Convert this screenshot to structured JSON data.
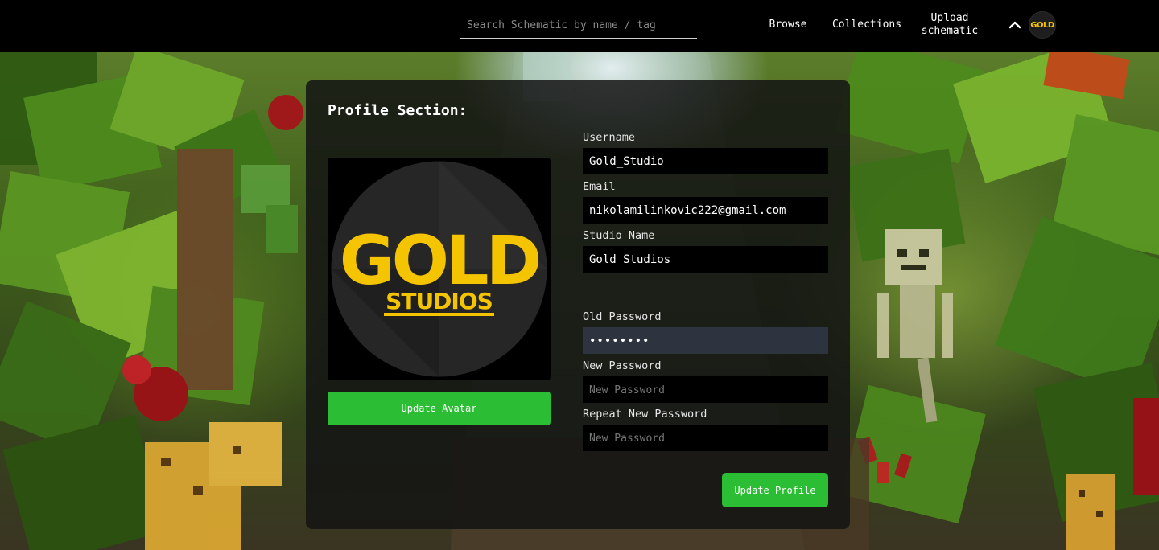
{
  "nav": {
    "search_placeholder": "Search Schematic by name / tag",
    "browse": "Browse",
    "collections": "Collections",
    "upload_line1": "Upload",
    "upload_line2": "schematic",
    "chevron": "chevron-up-icon",
    "avatar_text": "GOLD"
  },
  "profile": {
    "title": "Profile Section:",
    "logo_main": "GOLD",
    "logo_sub": "STUDIOS",
    "update_avatar": "Update Avatar",
    "username_label": "Username",
    "username_value": "Gold_Studio",
    "email_label": "Email",
    "email_value": "nikolamilinkovic222@gmail.com",
    "studio_label": "Studio Name",
    "studio_value": "Gold Studios",
    "old_password_label": "Old Password",
    "old_password_value": "••••••••",
    "new_password_label": "New Password",
    "new_password_placeholder": "New Password",
    "repeat_password_label": "Repeat New Password",
    "repeat_password_placeholder": "New Password",
    "update_profile": "Update Profile"
  },
  "colors": {
    "accent_green": "#2bbd33",
    "logo_gold": "#f5c400",
    "card_bg": "#141414"
  }
}
